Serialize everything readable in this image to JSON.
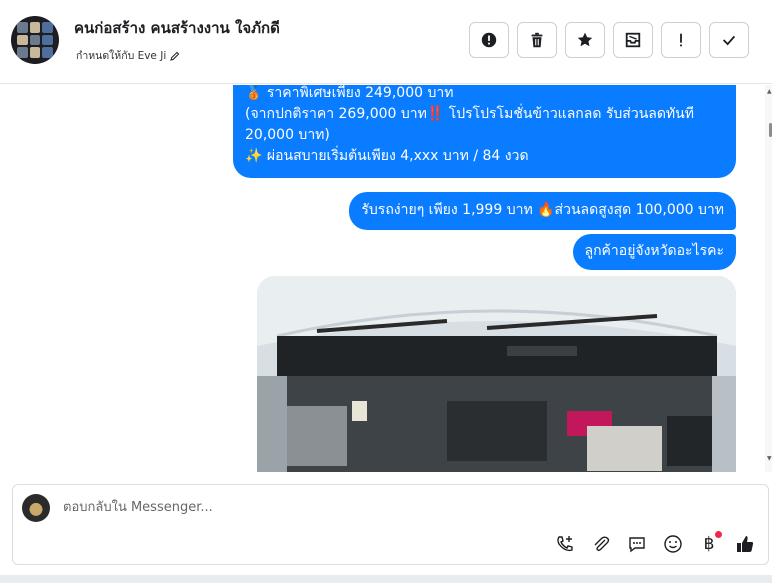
{
  "header": {
    "title": "คนก่อสร้าง คนสร้างงาน ใจภักดี",
    "assigned": "กำหนดให้กับ Eve Ji"
  },
  "actions": [
    {
      "name": "report-icon"
    },
    {
      "name": "trash-icon"
    },
    {
      "name": "star-icon"
    },
    {
      "name": "archive-icon"
    },
    {
      "name": "mark-important-icon"
    },
    {
      "name": "check-icon"
    }
  ],
  "messages": {
    "promo_line1": "🥉 ราคาพิเศษเพียง 249,000 บาท",
    "promo_line2": "(จากปกติราคา 269,000 บาท‼️ โปรโปรโมชั่นข้าวแลกลด รับส่วนลดทันที",
    "promo_line3": "20,000 บาท)",
    "promo_line4": "✨ ผ่อนสบายเริ่มต้นเพียง 4,xxx บาท / 84 งวด",
    "down_payment": "รับรถง่ายๆ เพียง 1,999 บาท 🔥ส่วนลดสูงสุด 100,000 บาท",
    "province_question": "ลูกค้าอยู่จังหวัดอะไรคะ"
  },
  "composer": {
    "placeholder": "ตอบกลับใน Messenger..."
  },
  "colors": {
    "bubble": "#0a7cff",
    "badge": "#f02849"
  }
}
